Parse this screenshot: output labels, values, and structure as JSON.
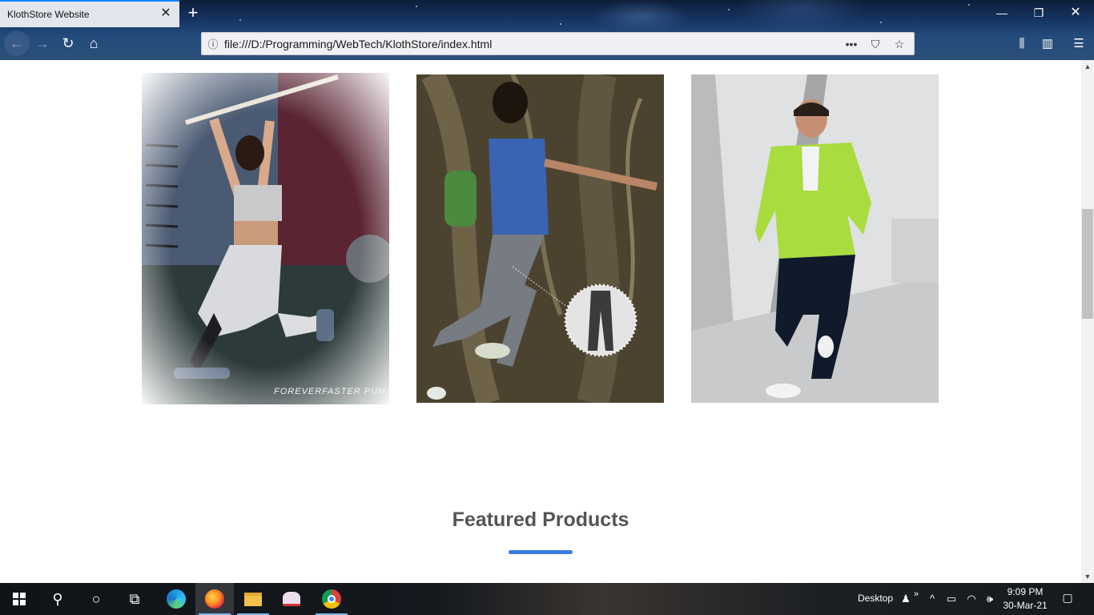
{
  "browser": {
    "tab_title": "KlothStore Website",
    "tab_close_glyph": "✕",
    "new_tab_glyph": "+",
    "url": "file:///D:/Programming/WebTech/KlothStore/index.html",
    "window_controls": {
      "minimize": "—",
      "maximize": "❐",
      "close": "✕"
    },
    "nav_icons": {
      "back": "←",
      "forward": "→",
      "reload": "↻",
      "home": "⌂"
    },
    "url_actions": {
      "info": "ⓘ",
      "more": "•••",
      "pocket": "⛉",
      "bookmark": "☆"
    },
    "right_icons": {
      "library": "⫼",
      "sidebar": "▥",
      "menu": "☰"
    }
  },
  "page": {
    "gallery": [
      {
        "name": "photo-woman-workout",
        "brand_text": "FOREVERFASTER PUMA"
      },
      {
        "name": "photo-woman-running-forest"
      },
      {
        "name": "photo-man-green-jacket"
      }
    ],
    "section_title": "Featured Products",
    "accent_color": "#3b7de0"
  },
  "scrollbar": {
    "up": "▲",
    "down": "▼"
  },
  "taskbar": {
    "desktop_label": "Desktop",
    "time": "9:09 PM",
    "date": "30-Mar-21",
    "icons": {
      "start": "windows-start-icon",
      "search": "search-icon",
      "cortana": "cortana-icon",
      "task_view": "task-view-icon"
    },
    "glyphs": {
      "search": "⚲",
      "cortana": "○",
      "task_view": "⧉",
      "person": "♟",
      "more": "»",
      "up": "^",
      "battery": "▭",
      "wifi": "◠",
      "volume": "🕪",
      "notification": "▢"
    }
  }
}
